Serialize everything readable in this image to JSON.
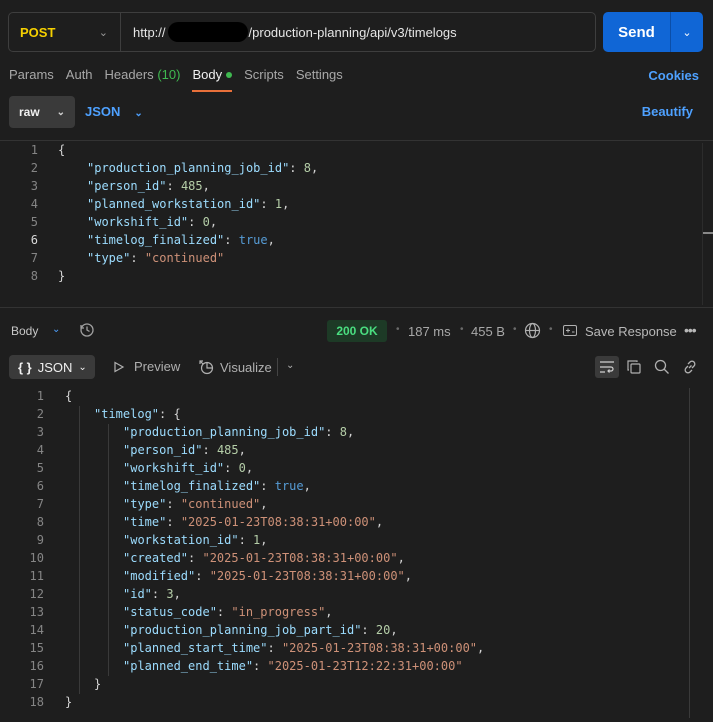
{
  "request": {
    "method": "POST",
    "url_prefix": "http://",
    "url_suffix": "/production-planning/api/v3/timelogs",
    "send_label": "Send"
  },
  "tabs": {
    "params": "Params",
    "auth": "Auth",
    "headers": "Headers",
    "headers_count": "(10)",
    "body": "Body",
    "scripts": "Scripts",
    "settings": "Settings",
    "cookies": "Cookies"
  },
  "body_mode": {
    "raw": "raw",
    "format": "JSON",
    "beautify": "Beautify"
  },
  "request_body": {
    "line_numbers": [
      "1",
      "2",
      "3",
      "4",
      "5",
      "6",
      "7",
      "8"
    ],
    "lines": [
      [
        {
          "t": "p",
          "v": "{"
        }
      ],
      [
        {
          "t": "k",
          "v": "\"production_planning_job_id\""
        },
        {
          "t": "p",
          "v": ": "
        },
        {
          "t": "n",
          "v": "8"
        },
        {
          "t": "p",
          "v": ","
        }
      ],
      [
        {
          "t": "k",
          "v": "\"person_id\""
        },
        {
          "t": "p",
          "v": ": "
        },
        {
          "t": "n",
          "v": "485"
        },
        {
          "t": "p",
          "v": ","
        }
      ],
      [
        {
          "t": "k",
          "v": "\"planned_workstation_id\""
        },
        {
          "t": "p",
          "v": ": "
        },
        {
          "t": "n",
          "v": "1"
        },
        {
          "t": "p",
          "v": ","
        }
      ],
      [
        {
          "t": "k",
          "v": "\"workshift_id\""
        },
        {
          "t": "p",
          "v": ": "
        },
        {
          "t": "n",
          "v": "0"
        },
        {
          "t": "p",
          "v": ","
        }
      ],
      [
        {
          "t": "k",
          "v": "\"timelog_finalized\""
        },
        {
          "t": "p",
          "v": ": "
        },
        {
          "t": "b",
          "v": "true"
        },
        {
          "t": "p",
          "v": ","
        }
      ],
      [
        {
          "t": "k",
          "v": "\"type\""
        },
        {
          "t": "p",
          "v": ": "
        },
        {
          "t": "s",
          "v": "\"continued\""
        }
      ],
      [
        {
          "t": "p",
          "v": "}"
        }
      ]
    ]
  },
  "response": {
    "body_label": "Body",
    "status": "200 OK",
    "time": "187 ms",
    "size": "455 B",
    "save_label": "Save Response",
    "view_format": "JSON",
    "preview_label": "Preview",
    "visualize_label": "Visualize",
    "line_numbers": [
      "1",
      "2",
      "3",
      "4",
      "5",
      "6",
      "7",
      "8",
      "9",
      "10",
      "11",
      "12",
      "13",
      "14",
      "15",
      "16",
      "17",
      "18"
    ],
    "lines": [
      [
        {
          "t": "p",
          "v": "{"
        }
      ],
      [
        {
          "t": "k",
          "v": "\"timelog\""
        },
        {
          "t": "p",
          "v": ": {"
        }
      ],
      [
        {
          "t": "k",
          "v": "\"production_planning_job_id\""
        },
        {
          "t": "p",
          "v": ": "
        },
        {
          "t": "n",
          "v": "8"
        },
        {
          "t": "p",
          "v": ","
        }
      ],
      [
        {
          "t": "k",
          "v": "\"person_id\""
        },
        {
          "t": "p",
          "v": ": "
        },
        {
          "t": "n",
          "v": "485"
        },
        {
          "t": "p",
          "v": ","
        }
      ],
      [
        {
          "t": "k",
          "v": "\"workshift_id\""
        },
        {
          "t": "p",
          "v": ": "
        },
        {
          "t": "n",
          "v": "0"
        },
        {
          "t": "p",
          "v": ","
        }
      ],
      [
        {
          "t": "k",
          "v": "\"timelog_finalized\""
        },
        {
          "t": "p",
          "v": ": "
        },
        {
          "t": "b",
          "v": "true"
        },
        {
          "t": "p",
          "v": ","
        }
      ],
      [
        {
          "t": "k",
          "v": "\"type\""
        },
        {
          "t": "p",
          "v": ": "
        },
        {
          "t": "s",
          "v": "\"continued\""
        },
        {
          "t": "p",
          "v": ","
        }
      ],
      [
        {
          "t": "k",
          "v": "\"time\""
        },
        {
          "t": "p",
          "v": ": "
        },
        {
          "t": "s",
          "v": "\"2025-01-23T08:38:31+00:00\""
        },
        {
          "t": "p",
          "v": ","
        }
      ],
      [
        {
          "t": "k",
          "v": "\"workstation_id\""
        },
        {
          "t": "p",
          "v": ": "
        },
        {
          "t": "n",
          "v": "1"
        },
        {
          "t": "p",
          "v": ","
        }
      ],
      [
        {
          "t": "k",
          "v": "\"created\""
        },
        {
          "t": "p",
          "v": ": "
        },
        {
          "t": "s",
          "v": "\"2025-01-23T08:38:31+00:00\""
        },
        {
          "t": "p",
          "v": ","
        }
      ],
      [
        {
          "t": "k",
          "v": "\"modified\""
        },
        {
          "t": "p",
          "v": ": "
        },
        {
          "t": "s",
          "v": "\"2025-01-23T08:38:31+00:00\""
        },
        {
          "t": "p",
          "v": ","
        }
      ],
      [
        {
          "t": "k",
          "v": "\"id\""
        },
        {
          "t": "p",
          "v": ": "
        },
        {
          "t": "n",
          "v": "3"
        },
        {
          "t": "p",
          "v": ","
        }
      ],
      [
        {
          "t": "k",
          "v": "\"status_code\""
        },
        {
          "t": "p",
          "v": ": "
        },
        {
          "t": "s",
          "v": "\"in_progress\""
        },
        {
          "t": "p",
          "v": ","
        }
      ],
      [
        {
          "t": "k",
          "v": "\"production_planning_job_part_id\""
        },
        {
          "t": "p",
          "v": ": "
        },
        {
          "t": "n",
          "v": "20"
        },
        {
          "t": "p",
          "v": ","
        }
      ],
      [
        {
          "t": "k",
          "v": "\"planned_start_time\""
        },
        {
          "t": "p",
          "v": ": "
        },
        {
          "t": "s",
          "v": "\"2025-01-23T08:38:31+00:00\""
        },
        {
          "t": "p",
          "v": ","
        }
      ],
      [
        {
          "t": "k",
          "v": "\"planned_end_time\""
        },
        {
          "t": "p",
          "v": ": "
        },
        {
          "t": "s",
          "v": "\"2025-01-23T12:22:31+00:00\""
        }
      ],
      [
        {
          "t": "p",
          "v": "}"
        }
      ],
      [
        {
          "t": "p",
          "v": "}"
        }
      ]
    ]
  },
  "colors": {
    "method": "#f5d000",
    "send": "#1066d6",
    "accent_link": "#4ea1ff",
    "status_ok": "#4ade80",
    "active_tab_underline": "#e8703a"
  }
}
